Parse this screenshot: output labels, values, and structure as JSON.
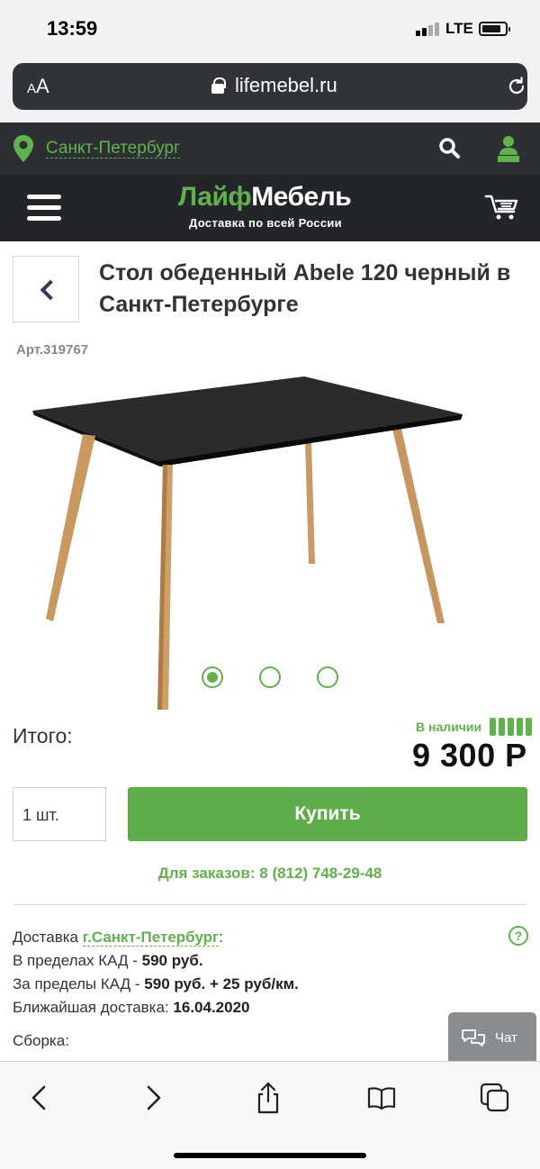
{
  "status_bar": {
    "time": "13:59",
    "network": "LTE"
  },
  "browser": {
    "text_size_small": "A",
    "text_size_large": "A",
    "domain": "lifemebel.ru"
  },
  "site_header": {
    "city": "Санкт-Петербург",
    "logo_green": "Лайф",
    "logo_white": "Мебель",
    "tagline": "Доставка по всей России"
  },
  "product": {
    "title": "Стол обеденный Abele 120 черный в Санкт-Петербурге",
    "sku": "Арт.319767",
    "gallery": {
      "slides": 3,
      "active_slide": 1
    },
    "total_label": "Итого:",
    "stock_label": "В наличии",
    "stock_level": 5,
    "price": "9 300 Р",
    "quantity": "1 шт.",
    "buy_label": "Купить",
    "order_phone": "Для заказов: 8 (812) 748-29-48"
  },
  "delivery": {
    "label": "Доставка",
    "city": "г.Санкт-Петербург",
    "colon": ":",
    "within_label": "В пределах КАД - ",
    "within_price": "590 руб.",
    "outside_label": "За пределы КАД - ",
    "outside_price": "590 руб. + 25 руб/км.",
    "nearest_label": "Ближайшая доставка: ",
    "nearest_date": "16.04.2020",
    "help": "?",
    "assembly_label": "Сборка:"
  },
  "chat": {
    "label": "Чат"
  },
  "colors": {
    "brand_green": "#5fb34a",
    "header_dark": "#232629",
    "button_green": "#5fad48"
  }
}
